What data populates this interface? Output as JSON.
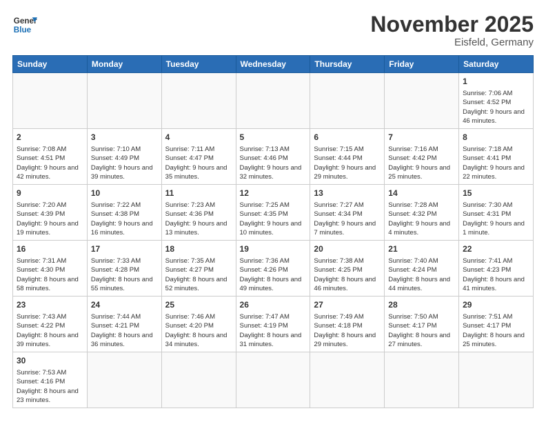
{
  "header": {
    "logo_general": "General",
    "logo_blue": "Blue",
    "title": "November 2025",
    "subtitle": "Eisfeld, Germany"
  },
  "weekdays": [
    "Sunday",
    "Monday",
    "Tuesday",
    "Wednesday",
    "Thursday",
    "Friday",
    "Saturday"
  ],
  "weeks": [
    [
      {
        "day": "",
        "info": ""
      },
      {
        "day": "",
        "info": ""
      },
      {
        "day": "",
        "info": ""
      },
      {
        "day": "",
        "info": ""
      },
      {
        "day": "",
        "info": ""
      },
      {
        "day": "",
        "info": ""
      },
      {
        "day": "1",
        "info": "Sunrise: 7:06 AM\nSunset: 4:52 PM\nDaylight: 9 hours\nand 46 minutes."
      }
    ],
    [
      {
        "day": "2",
        "info": "Sunrise: 7:08 AM\nSunset: 4:51 PM\nDaylight: 9 hours\nand 42 minutes."
      },
      {
        "day": "3",
        "info": "Sunrise: 7:10 AM\nSunset: 4:49 PM\nDaylight: 9 hours\nand 39 minutes."
      },
      {
        "day": "4",
        "info": "Sunrise: 7:11 AM\nSunset: 4:47 PM\nDaylight: 9 hours\nand 35 minutes."
      },
      {
        "day": "5",
        "info": "Sunrise: 7:13 AM\nSunset: 4:46 PM\nDaylight: 9 hours\nand 32 minutes."
      },
      {
        "day": "6",
        "info": "Sunrise: 7:15 AM\nSunset: 4:44 PM\nDaylight: 9 hours\nand 29 minutes."
      },
      {
        "day": "7",
        "info": "Sunrise: 7:16 AM\nSunset: 4:42 PM\nDaylight: 9 hours\nand 25 minutes."
      },
      {
        "day": "8",
        "info": "Sunrise: 7:18 AM\nSunset: 4:41 PM\nDaylight: 9 hours\nand 22 minutes."
      }
    ],
    [
      {
        "day": "9",
        "info": "Sunrise: 7:20 AM\nSunset: 4:39 PM\nDaylight: 9 hours\nand 19 minutes."
      },
      {
        "day": "10",
        "info": "Sunrise: 7:22 AM\nSunset: 4:38 PM\nDaylight: 9 hours\nand 16 minutes."
      },
      {
        "day": "11",
        "info": "Sunrise: 7:23 AM\nSunset: 4:36 PM\nDaylight: 9 hours\nand 13 minutes."
      },
      {
        "day": "12",
        "info": "Sunrise: 7:25 AM\nSunset: 4:35 PM\nDaylight: 9 hours\nand 10 minutes."
      },
      {
        "day": "13",
        "info": "Sunrise: 7:27 AM\nSunset: 4:34 PM\nDaylight: 9 hours\nand 7 minutes."
      },
      {
        "day": "14",
        "info": "Sunrise: 7:28 AM\nSunset: 4:32 PM\nDaylight: 9 hours\nand 4 minutes."
      },
      {
        "day": "15",
        "info": "Sunrise: 7:30 AM\nSunset: 4:31 PM\nDaylight: 9 hours\nand 1 minute."
      }
    ],
    [
      {
        "day": "16",
        "info": "Sunrise: 7:31 AM\nSunset: 4:30 PM\nDaylight: 8 hours\nand 58 minutes."
      },
      {
        "day": "17",
        "info": "Sunrise: 7:33 AM\nSunset: 4:28 PM\nDaylight: 8 hours\nand 55 minutes."
      },
      {
        "day": "18",
        "info": "Sunrise: 7:35 AM\nSunset: 4:27 PM\nDaylight: 8 hours\nand 52 minutes."
      },
      {
        "day": "19",
        "info": "Sunrise: 7:36 AM\nSunset: 4:26 PM\nDaylight: 8 hours\nand 49 minutes."
      },
      {
        "day": "20",
        "info": "Sunrise: 7:38 AM\nSunset: 4:25 PM\nDaylight: 8 hours\nand 46 minutes."
      },
      {
        "day": "21",
        "info": "Sunrise: 7:40 AM\nSunset: 4:24 PM\nDaylight: 8 hours\nand 44 minutes."
      },
      {
        "day": "22",
        "info": "Sunrise: 7:41 AM\nSunset: 4:23 PM\nDaylight: 8 hours\nand 41 minutes."
      }
    ],
    [
      {
        "day": "23",
        "info": "Sunrise: 7:43 AM\nSunset: 4:22 PM\nDaylight: 8 hours\nand 39 minutes."
      },
      {
        "day": "24",
        "info": "Sunrise: 7:44 AM\nSunset: 4:21 PM\nDaylight: 8 hours\nand 36 minutes."
      },
      {
        "day": "25",
        "info": "Sunrise: 7:46 AM\nSunset: 4:20 PM\nDaylight: 8 hours\nand 34 minutes."
      },
      {
        "day": "26",
        "info": "Sunrise: 7:47 AM\nSunset: 4:19 PM\nDaylight: 8 hours\nand 31 minutes."
      },
      {
        "day": "27",
        "info": "Sunrise: 7:49 AM\nSunset: 4:18 PM\nDaylight: 8 hours\nand 29 minutes."
      },
      {
        "day": "28",
        "info": "Sunrise: 7:50 AM\nSunset: 4:17 PM\nDaylight: 8 hours\nand 27 minutes."
      },
      {
        "day": "29",
        "info": "Sunrise: 7:51 AM\nSunset: 4:17 PM\nDaylight: 8 hours\nand 25 minutes."
      }
    ],
    [
      {
        "day": "30",
        "info": "Sunrise: 7:53 AM\nSunset: 4:16 PM\nDaylight: 8 hours\nand 23 minutes."
      },
      {
        "day": "",
        "info": ""
      },
      {
        "day": "",
        "info": ""
      },
      {
        "day": "",
        "info": ""
      },
      {
        "day": "",
        "info": ""
      },
      {
        "day": "",
        "info": ""
      },
      {
        "day": "",
        "info": ""
      }
    ]
  ]
}
